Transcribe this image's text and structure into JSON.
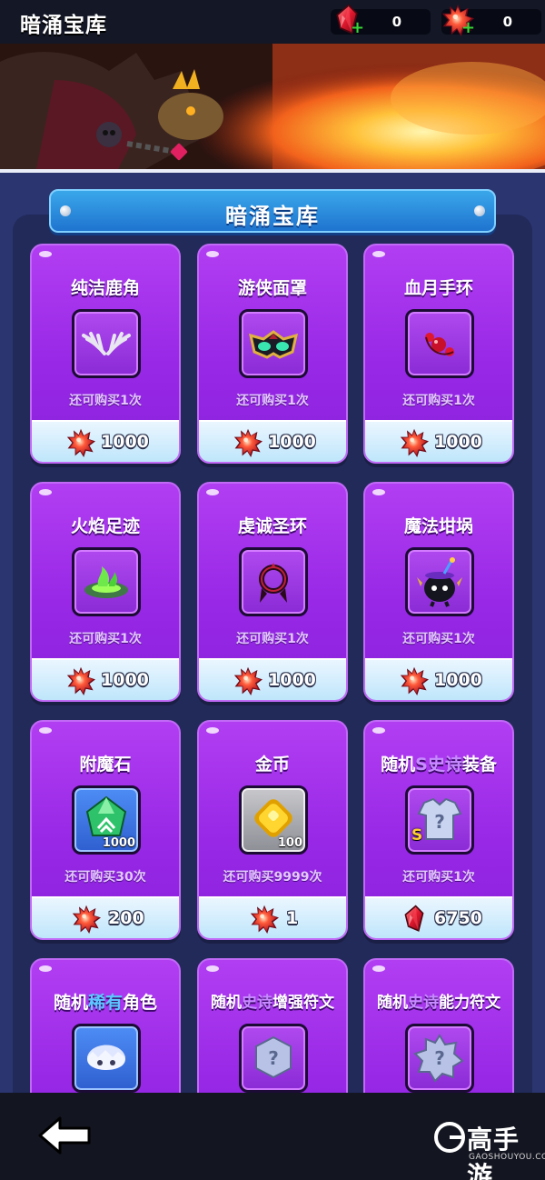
{
  "header": {
    "title": "暗涌宝库",
    "currencies": [
      {
        "icon": "red-crystal-icon",
        "value": "0",
        "add": "+"
      },
      {
        "icon": "red-gem-star-icon",
        "value": "0",
        "add": "+"
      }
    ]
  },
  "banner": {
    "image": "dragon-breathing-fire-illustration"
  },
  "section": {
    "title": "暗涌宝库"
  },
  "items": [
    {
      "name": "纯洁鹿角",
      "icon": "white-antlers-icon",
      "limit": "还可购买1次",
      "price": "1000",
      "currency": "red-gem-star-icon"
    },
    {
      "name": "游侠面罩",
      "icon": "ranger-mask-icon",
      "limit": "还可购买1次",
      "price": "1000",
      "currency": "red-gem-star-icon"
    },
    {
      "name": "血月手环",
      "icon": "blood-moon-bracelet-icon",
      "limit": "还可购买1次",
      "price": "1000",
      "currency": "red-gem-star-icon"
    },
    {
      "name": "火焰足迹",
      "icon": "flame-footprint-icon",
      "limit": "还可购买1次",
      "price": "1000",
      "currency": "red-gem-star-icon"
    },
    {
      "name": "虔诚圣环",
      "icon": "devout-halo-icon",
      "limit": "还可购买1次",
      "price": "1000",
      "currency": "red-gem-star-icon"
    },
    {
      "name": "魔法坩埚",
      "icon": "magic-cauldron-icon",
      "limit": "还可购买1次",
      "price": "1000",
      "currency": "red-gem-star-icon"
    },
    {
      "name": "附魔石",
      "icon": "enchant-stone-icon",
      "qty": "1000",
      "limit": "还可购买30次",
      "price": "200",
      "currency": "red-gem-star-icon"
    },
    {
      "name": "金币",
      "icon": "gold-coin-icon",
      "qty": "100",
      "limit": "还可购买9999次",
      "price": "1",
      "currency": "red-gem-star-icon"
    },
    {
      "name_parts": [
        "随机",
        "S史诗",
        "装备"
      ],
      "icon": "epic-armor-mystery-icon",
      "badge": "S",
      "limit": "还可购买1次",
      "price": "6750",
      "currency": "red-crystal-icon"
    },
    {
      "name_parts": [
        "随机",
        "稀有",
        "角色"
      ],
      "icon": "rare-character-icon"
    },
    {
      "name_parts": [
        "随机",
        "史诗",
        "增强符文"
      ],
      "icon": "mystery-rune-icon"
    },
    {
      "name_parts": [
        "随机",
        "史诗",
        "能力符文"
      ],
      "icon": "mystery-rune-icon"
    }
  ],
  "footer": {
    "back_icon": "back-arrow-icon",
    "watermark": {
      "text": "高手游",
      "sub": "GAOSHOUYOU.COM"
    }
  },
  "colors": {
    "card": "#9828e6",
    "price_bar": "#cfe9fb",
    "section_banner": "#2b8fe0",
    "background": "#2b3570"
  }
}
